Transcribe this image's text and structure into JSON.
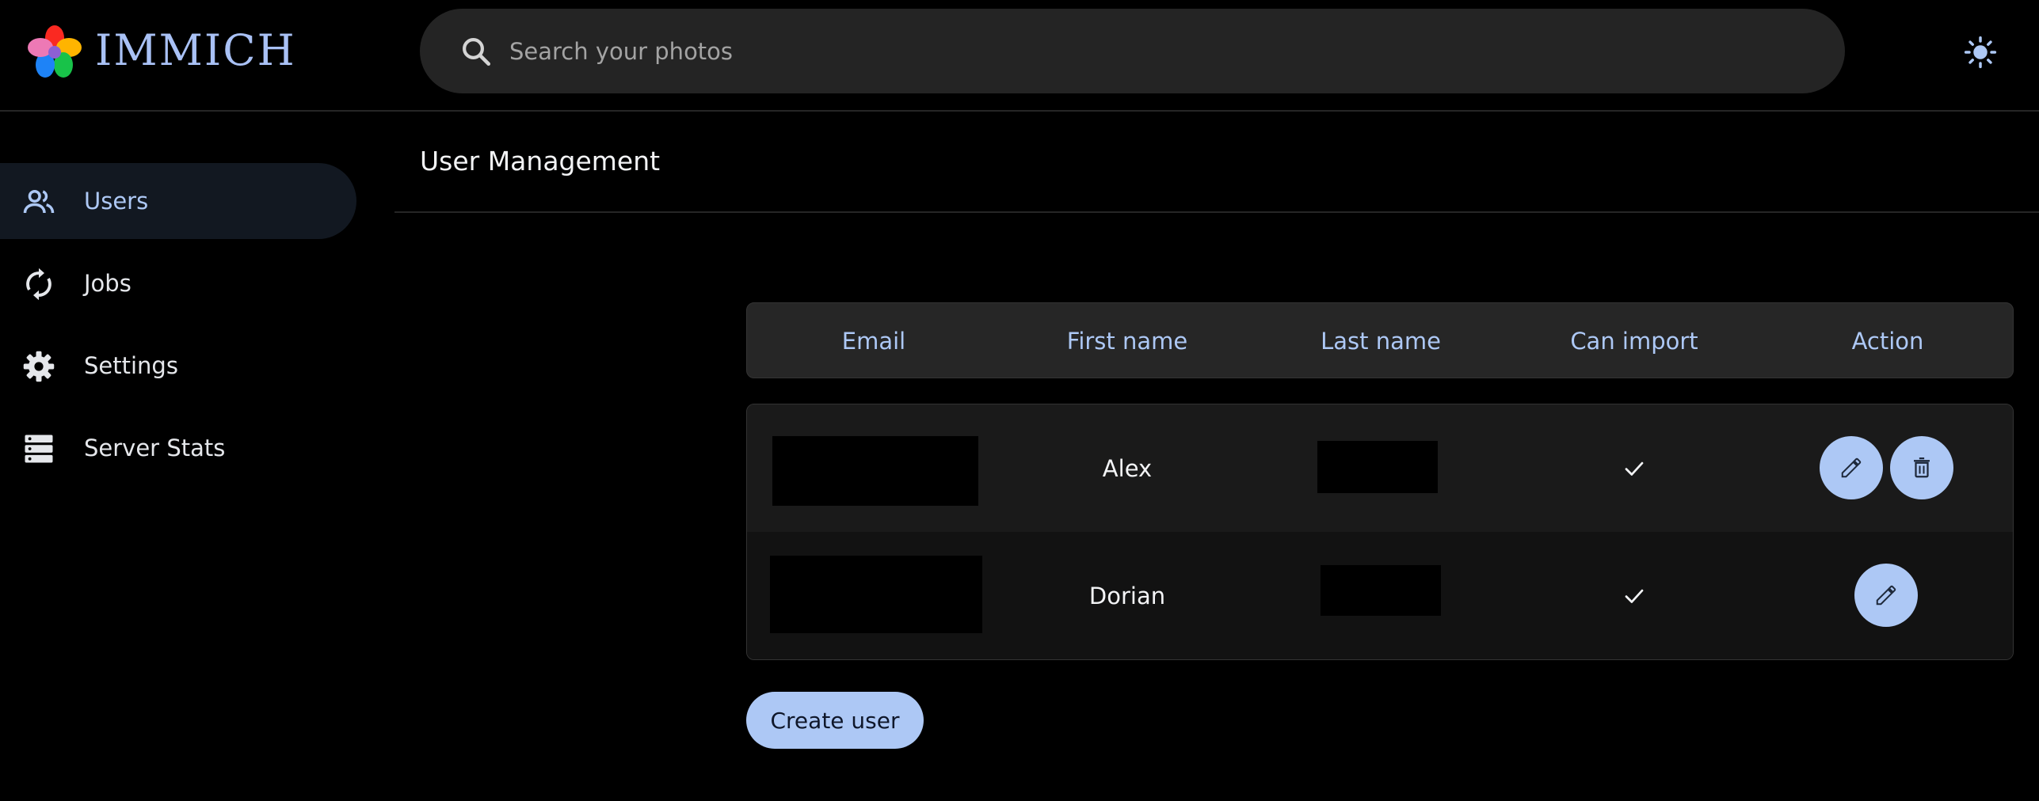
{
  "app": {
    "name": "IMMICH",
    "logo_icon": "immich-logo-icon"
  },
  "header": {
    "search": {
      "placeholder": "Search your photos",
      "value": "",
      "icon": "search-icon"
    },
    "theme_toggle_icon": "sun-icon"
  },
  "sidebar": {
    "items": [
      {
        "label": "Users",
        "icon": "users-icon",
        "active": true
      },
      {
        "label": "Jobs",
        "icon": "sync-icon",
        "active": false
      },
      {
        "label": "Settings",
        "icon": "gear-icon",
        "active": false
      },
      {
        "label": "Server Stats",
        "icon": "server-icon",
        "active": false
      }
    ]
  },
  "main": {
    "title": "User Management",
    "table": {
      "columns": [
        "Email",
        "First name",
        "Last name",
        "Can import",
        "Action"
      ],
      "rows": [
        {
          "email": "",
          "first_name": "Alex",
          "last_name": "",
          "can_import": true,
          "actions": [
            "edit",
            "delete"
          ]
        },
        {
          "email": "",
          "first_name": "Dorian",
          "last_name": "",
          "can_import": true,
          "actions": [
            "edit"
          ]
        }
      ]
    },
    "create_button_label": "Create user"
  },
  "colors": {
    "background": "#000000",
    "accent": "#adc8f5",
    "header_row": "#262626",
    "active_nav": "#121821"
  }
}
